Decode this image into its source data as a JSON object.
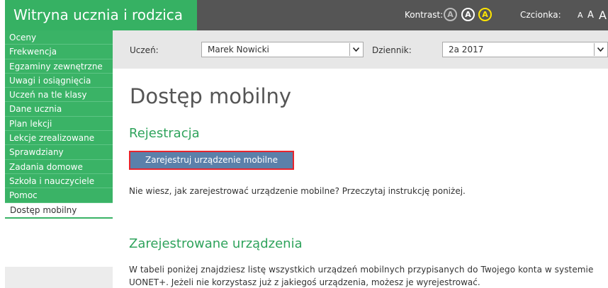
{
  "app": {
    "title": "Witryna ucznia i rodzica"
  },
  "topbar": {
    "contrast_label": "Kontrast:",
    "contrast_options": [
      "A",
      "A",
      "A"
    ],
    "font_label": "Czcionka:",
    "font_sizes": [
      "A",
      "A",
      "A"
    ]
  },
  "sidebar": {
    "items": [
      {
        "label": "Oceny"
      },
      {
        "label": "Frekwencja"
      },
      {
        "label": "Egzaminy zewnętrzne"
      },
      {
        "label": "Uwagi i osiągnięcia"
      },
      {
        "label": "Uczeń na tle klasy"
      },
      {
        "label": "Dane ucznia"
      },
      {
        "label": "Plan lekcji"
      },
      {
        "label": "Lekcje zrealizowane"
      },
      {
        "label": "Sprawdziany"
      },
      {
        "label": "Zadania domowe"
      },
      {
        "label": "Szkoła i nauczyciele"
      },
      {
        "label": "Pomoc"
      },
      {
        "label": "Dostęp mobilny",
        "active": true
      }
    ]
  },
  "filters": {
    "student_label": "Uczeń:",
    "student_value": "Marek Nowicki",
    "journal_label": "Dziennik:",
    "journal_value": "2a 2017"
  },
  "main": {
    "title": "Dostęp mobilny",
    "registration_heading": "Rejestracja",
    "register_button": "Zarejestruj urządzenie mobilne",
    "help_text": "Nie wiesz, jak zarejestrować urządzenie mobilne? Przeczytaj instrukcję poniżej.",
    "devices_heading": "Zarejestrowane urządzenia",
    "devices_text_line1": "W tabeli poniżej znajdziesz listę wszystkich urządzeń mobilnych przypisanych do Twojego konta w systemie",
    "devices_text_line2": "UONET+. Jeżeli nie korzystasz już z jakiegoś urządzenia, możesz je wyrejestrować."
  },
  "colors": {
    "brand_green": "#36b163",
    "topbar_gray": "#555555",
    "button_blue": "#5b80aa",
    "highlight_red": "#e8242c"
  }
}
